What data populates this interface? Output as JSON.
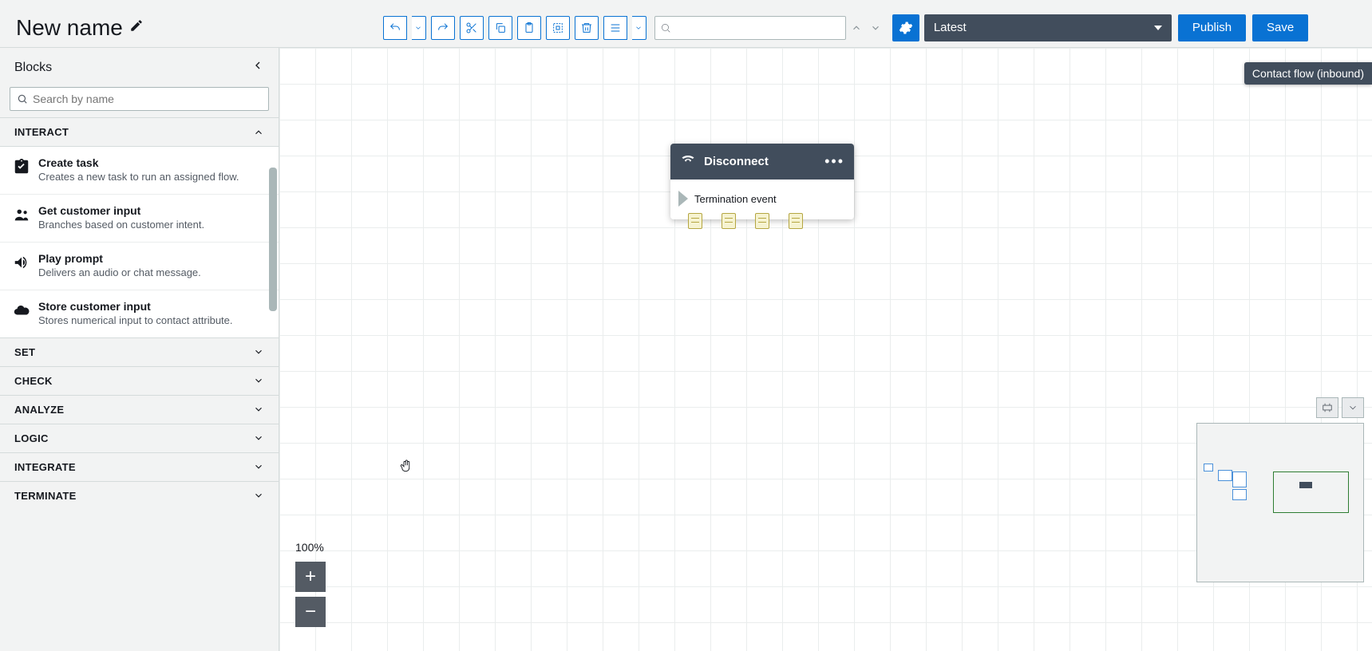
{
  "title": "New name",
  "toolbar": {
    "search_placeholder": ""
  },
  "version_selector": {
    "selected": "Latest"
  },
  "buttons": {
    "publish": "Publish",
    "save": "Save"
  },
  "flow_label": "Contact flow (inbound)",
  "sidebar": {
    "title": "Blocks",
    "search_placeholder": "Search by name",
    "categories": [
      {
        "name": "INTERACT",
        "expanded": true,
        "items": [
          {
            "title": "Create task",
            "desc": "Creates a new task to run an assigned flow.",
            "icon": "task"
          },
          {
            "title": "Get customer input",
            "desc": "Branches based on customer intent.",
            "icon": "people"
          },
          {
            "title": "Play prompt",
            "desc": "Delivers an audio or chat message.",
            "icon": "speaker"
          },
          {
            "title": "Store customer input",
            "desc": "Stores numerical input to contact attribute.",
            "icon": "cloud"
          }
        ]
      },
      {
        "name": "SET",
        "expanded": false
      },
      {
        "name": "CHECK",
        "expanded": false
      },
      {
        "name": "ANALYZE",
        "expanded": false
      },
      {
        "name": "LOGIC",
        "expanded": false
      },
      {
        "name": "INTEGRATE",
        "expanded": false
      },
      {
        "name": "TERMINATE",
        "expanded": false
      }
    ]
  },
  "canvas": {
    "zoom": "100%",
    "nodes": [
      {
        "type": "Disconnect",
        "body": "Termination event"
      }
    ]
  }
}
